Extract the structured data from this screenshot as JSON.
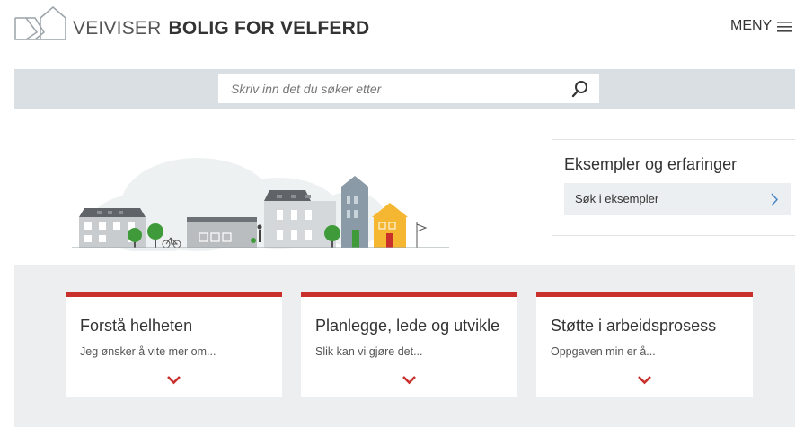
{
  "header": {
    "brand_light": "VEIVISER",
    "brand_bold": "BOLIG FOR VELFERD",
    "menu_label": "MENY"
  },
  "search": {
    "placeholder": "Skriv inn det du søker etter",
    "value": ""
  },
  "examples": {
    "title": "Eksempler og erfaringer",
    "link_label": "Søk i eksempler"
  },
  "cards": [
    {
      "title": "Forstå helheten",
      "subtitle": "Jeg ønsker å vite mer om..."
    },
    {
      "title": "Planlegge, lede og utvikle",
      "subtitle": "Slik kan vi gjøre det..."
    },
    {
      "title": "Støtte i arbeidsprosess",
      "subtitle": "Oppgaven min er å..."
    }
  ],
  "icons": {
    "logo": "house-outline-logo-icon",
    "menu": "hamburger-icon",
    "search": "magnifier-icon",
    "examples_link": "chevron-right-icon",
    "card": "chevron-down-icon"
  },
  "colors": {
    "accent_red": "#c9302c",
    "search_band": "#d9dfe3",
    "band": "#eceef0",
    "house_yellow": "#f5b731",
    "tree_green": "#3f9b3a"
  }
}
